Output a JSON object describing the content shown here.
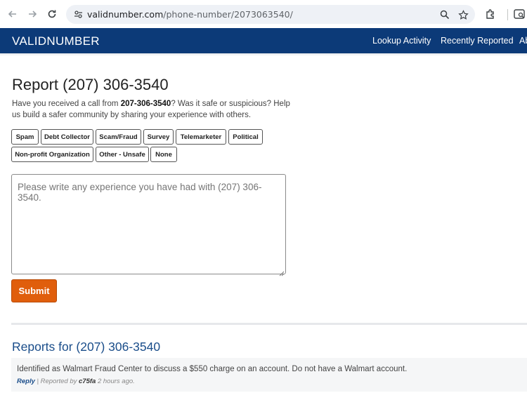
{
  "browser": {
    "url_host": "validnumber.com",
    "url_path": "/phone-number/2073063540/"
  },
  "site": {
    "logo": "VALIDNUMBER",
    "nav": [
      "Lookup Activity",
      "Recently Reported",
      "Ab"
    ]
  },
  "report": {
    "title": "Report (207) 306-3540",
    "intro_before": "Have you received a call from ",
    "intro_number": "207-306-3540",
    "intro_after": "? Was it safe or suspicious? Help us build a safer community by sharing your experience with others.",
    "tags": [
      "Spam",
      "Debt Collector",
      "Scam/Fraud",
      "Survey",
      "Telemarketer",
      "Political",
      "Non-profit Organization",
      "Other - Unsafe",
      "None"
    ],
    "placeholder": "Please write any experience you have had with (207) 306-3540.",
    "submit_label": "Submit"
  },
  "reports": {
    "title": "Reports for (207) 306-3540",
    "items": [
      {
        "text": "Identified as Walmart Fraud Center to discuss a $550 charge on an account. Do not have a Walmart account.",
        "reply_label": "Reply",
        "separator": " | Reported by ",
        "user": "c75fa",
        "time": " 2 hours ago."
      }
    ]
  },
  "colors": {
    "navbar": "#0c3a78",
    "accent_orange": "#e05e0c",
    "link_blue": "#1a4d8a"
  },
  "icons": [
    "back-icon",
    "forward-icon",
    "reload-icon",
    "site-info-icon",
    "zoom-icon",
    "bookmark-star-icon",
    "extensions-icon",
    "tab-search-icon"
  ]
}
